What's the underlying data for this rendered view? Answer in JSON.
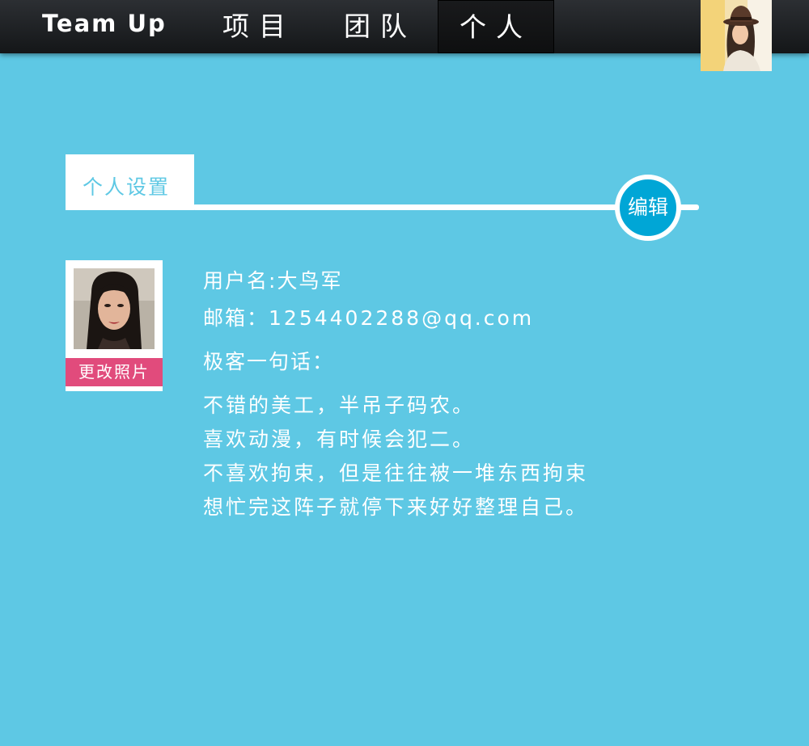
{
  "nav": {
    "logo": "Team Up",
    "items": [
      {
        "label": "项目"
      },
      {
        "label": "团队"
      },
      {
        "label": "个人"
      }
    ]
  },
  "section": {
    "title": "个人设置",
    "edit_label": "编辑"
  },
  "profile": {
    "change_photo_label": "更改照片",
    "username_label": "用户名:",
    "username": "大鸟军",
    "email_label": "邮箱：",
    "email": "1254402288@qq.com",
    "motto_label": "极客一句话：",
    "motto_lines": [
      "不错的美工，半吊子码农。",
      "喜欢动漫，有时候会犯二。",
      "不喜欢拘束，但是往往被一堆东西拘束",
      "想忙完这阵子就停下来好好整理自己。"
    ]
  },
  "colors": {
    "background": "#5ec8e4",
    "nav_bar": "#1c1e21",
    "accent_blue": "#00a6d6",
    "accent_pink": "#e14b7c"
  },
  "icons": {
    "nav_avatar": "user-avatar-photo",
    "profile_photo": "profile-photo"
  }
}
